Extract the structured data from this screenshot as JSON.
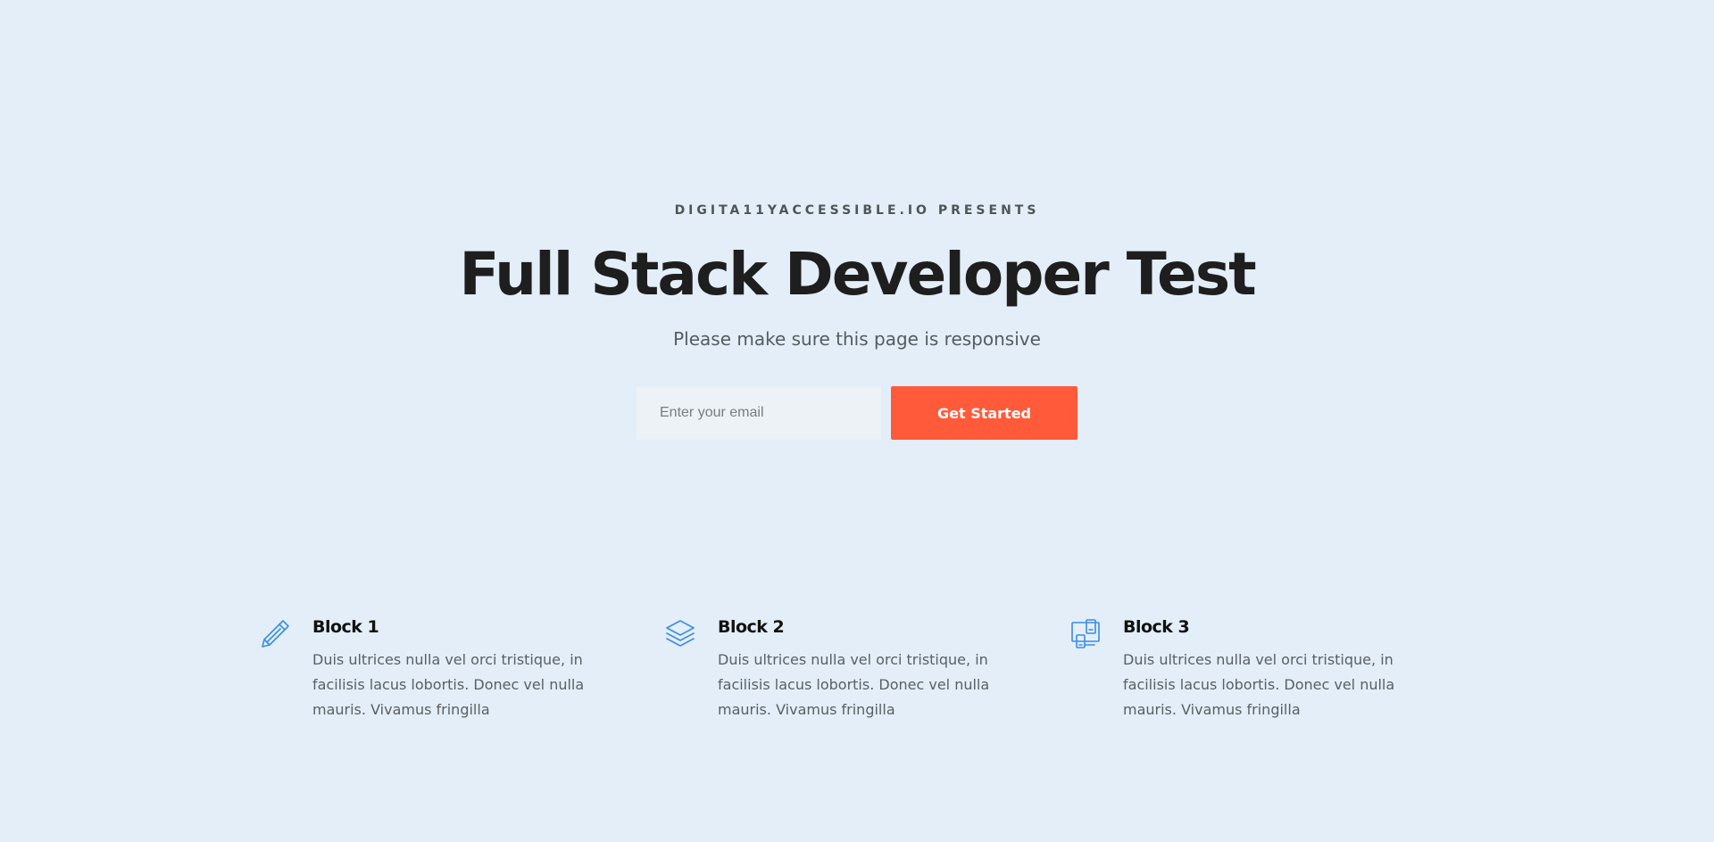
{
  "hero": {
    "eyebrow": "DIGITA11YACCESSIBLE.IO PRESENTS",
    "title": "Full Stack Developer Test",
    "subtitle": "Please make sure this page is responsive"
  },
  "signup": {
    "email_placeholder": "Enter your email",
    "button_label": "Get Started"
  },
  "features": [
    {
      "icon": "pencil-icon",
      "title": "Block 1",
      "text": "Duis ultrices nulla vel orci tristique, in facilisis lacus lobortis. Donec vel nulla mauris. Vivamus fringilla"
    },
    {
      "icon": "layers-icon",
      "title": "Block 2",
      "text": "Duis ultrices nulla vel orci tristique, in facilisis lacus lobortis. Donec vel nulla mauris. Vivamus fringilla"
    },
    {
      "icon": "devices-icon",
      "title": "Block 3",
      "text": "Duis ultrices nulla vel orci tristique, in facilisis lacus lobortis. Donec vel nulla mauris. Vivamus fringilla"
    }
  ],
  "colors": {
    "background": "#e3eef8",
    "accent": "#ff5a3a",
    "icon": "#3b8de0"
  }
}
